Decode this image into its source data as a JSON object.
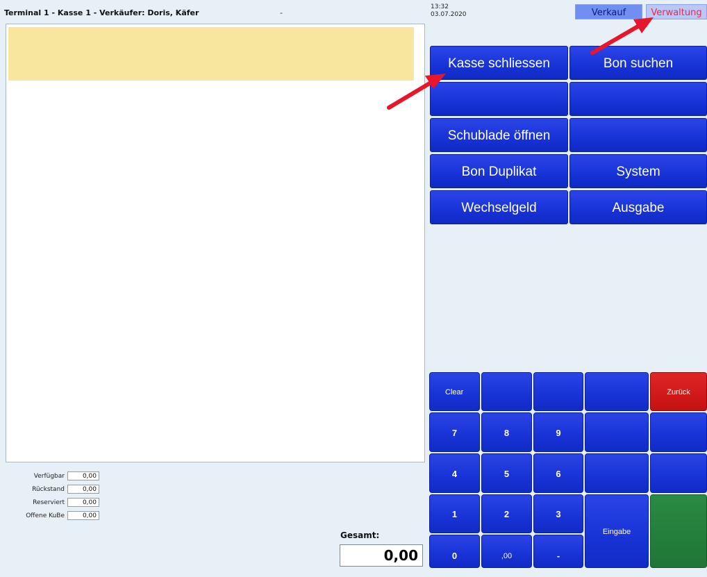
{
  "header": {
    "title": "Terminal 1 - Kasse 1  -  Verkäufer: Doris, Käfer",
    "separator": "-",
    "time": "13:32",
    "date": "03.07.2020",
    "tabs": [
      "Verkauf",
      "Verwaltung"
    ]
  },
  "functions": {
    "kasse_schliessen": "Kasse schliessen",
    "bon_suchen": "Bon suchen",
    "schublade_oeffnen": "Schublade öffnen",
    "bon_duplikat": "Bon Duplikat",
    "system": "System",
    "wechselgeld": "Wechselgeld",
    "ausgabe": "Ausgabe"
  },
  "account": [
    {
      "label": "Verfügbar",
      "value": "0,00"
    },
    {
      "label": "Rückstand",
      "value": "0,00"
    },
    {
      "label": "Reserviert",
      "value": "0,00"
    },
    {
      "label": "Offene KuBe",
      "value": "0,00"
    }
  ],
  "total": {
    "label": "Gesamt:",
    "value": "0,00"
  },
  "keypad": {
    "clear": "Clear",
    "zurueck": "Zurück",
    "eingabe": "Eingabe",
    "k7": "7",
    "k8": "8",
    "k9": "9",
    "k4": "4",
    "k5": "5",
    "k6": "6",
    "k1": "1",
    "k2": "2",
    "k3": "3",
    "k0": "0",
    "k00": ",00",
    "kminus": "-"
  },
  "colors": {
    "button_blue": "#1a35d8",
    "zurueck_red": "#d41b1b",
    "green_key": "#25803d",
    "receipt_highlight": "#f9e69e",
    "annotation_arrow": "#e8162a"
  }
}
